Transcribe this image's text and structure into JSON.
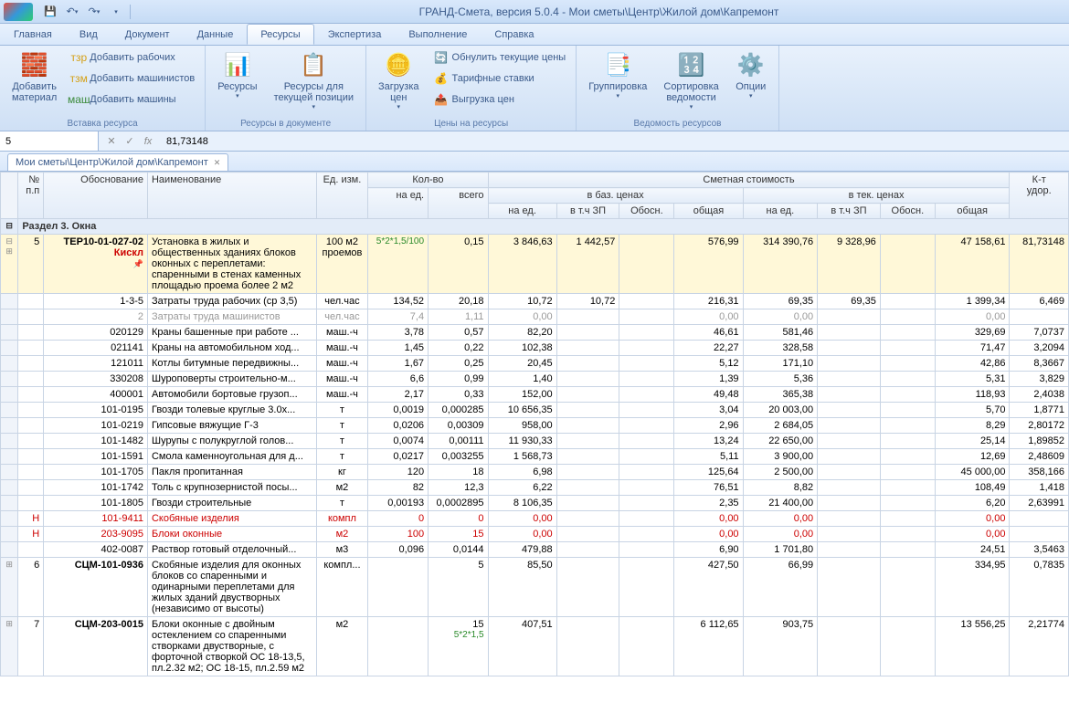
{
  "title": "ГРАНД-Смета, версия 5.0.4 - Мои сметы\\Центр\\Жилой дом\\Капремонт",
  "menu": [
    "Главная",
    "Вид",
    "Документ",
    "Данные",
    "Ресурсы",
    "Экспертиза",
    "Выполнение",
    "Справка"
  ],
  "menu_active": 4,
  "ribbon": {
    "g1": {
      "label": "Вставка ресурса",
      "add_mat": "Добавить\nматериал",
      "add_wrk": "Добавить рабочих",
      "add_mash": "Добавить машинистов",
      "add_m": "Добавить машины"
    },
    "g2": {
      "label": "Ресурсы в документе",
      "res": "Ресурсы",
      "res_pos": "Ресурсы для\nтекущей позиции"
    },
    "g3": {
      "label": "Цены на ресурсы",
      "load": "Загрузка\nцен",
      "reset": "Обнулить текущие цены",
      "tarif": "Тарифные ставки",
      "unload": "Выгрузка цен"
    },
    "g4": {
      "label": "Ведомость ресурсов",
      "grp": "Группировка",
      "sort": "Сортировка\nведомости",
      "opt": "Опции"
    }
  },
  "formula": {
    "cell": "5",
    "value": "81,73148"
  },
  "doc_tab": "Мои сметы\\Центр\\Жилой дом\\Капремонт",
  "headers": {
    "npp": "№\nп.п",
    "obos": "Обоснование",
    "name": "Наименование",
    "ed": "Ед. изм.",
    "kv": "Кол-во",
    "kv_ed": "на ед.",
    "kv_all": "всего",
    "sm": "Сметная стоимость",
    "baz": "в баз. ценах",
    "tek": "в тек. ценах",
    "na_ed": "на ед.",
    "zp": "в т.ч ЗП",
    "obosn": "Обосн.",
    "obsh": "общая",
    "kt": "К-т\nудор."
  },
  "section": "Раздел 3. Окна",
  "rows": [
    {
      "n": "5",
      "o": "ТЕР10-01-027-02",
      "kiskl": "Кискл",
      "nm": "Установка в жилых и общественных зданиях блоков оконных с переплетами: спаренными в стенах каменных площадью проема более 2 м2",
      "ed": "100 м2 проемов",
      "kved": "",
      "kvedf": "5*2*1,5/100",
      "kvall": "0,15",
      "b1": "3 846,63",
      "b2": "1 442,57",
      "b3": "",
      "b4": "576,99",
      "t1": "314 390,76",
      "t2": "9 328,96",
      "t3": "",
      "t4": "47 158,61",
      "kt": "81,73148",
      "main": true,
      "pin": true
    },
    {
      "o": "1-3-5",
      "nm": "Затраты труда рабочих (ср 3,5)",
      "ed": "чел.час",
      "kved": "134,52",
      "kvall": "20,18",
      "b1": "10,72",
      "b2": "10,72",
      "b4": "216,31",
      "t1": "69,35",
      "t2": "69,35",
      "t4": "1 399,34",
      "kt": "6,469"
    },
    {
      "o": "2",
      "nm": "Затраты труда машинистов",
      "ed": "чел.час",
      "kved": "7,4",
      "kvall": "1,11",
      "b1": "0,00",
      "b4": "0,00",
      "t1": "0,00",
      "t4": "0,00",
      "gray": true
    },
    {
      "o": "020129",
      "nm": "Краны башенные при работе ...",
      "ed": "маш.-ч",
      "kved": "3,78",
      "kvall": "0,57",
      "b1": "82,20",
      "b4": "46,61",
      "t1": "581,46",
      "t4": "329,69",
      "kt": "7,0737"
    },
    {
      "o": "021141",
      "nm": "Краны на автомобильном ход...",
      "ed": "маш.-ч",
      "kved": "1,45",
      "kvall": "0,22",
      "b1": "102,38",
      "b4": "22,27",
      "t1": "328,58",
      "t4": "71,47",
      "kt": "3,2094"
    },
    {
      "o": "121011",
      "nm": "Котлы битумные передвижны...",
      "ed": "маш.-ч",
      "kved": "1,67",
      "kvall": "0,25",
      "b1": "20,45",
      "b4": "5,12",
      "t1": "171,10",
      "t4": "42,86",
      "kt": "8,3667"
    },
    {
      "o": "330208",
      "nm": "Шуроповерты строительно-м...",
      "ed": "маш.-ч",
      "kved": "6,6",
      "kvall": "0,99",
      "b1": "1,40",
      "b4": "1,39",
      "t1": "5,36",
      "t4": "5,31",
      "kt": "3,829"
    },
    {
      "o": "400001",
      "nm": "Автомобили бортовые грузоп...",
      "ed": "маш.-ч",
      "kved": "2,17",
      "kvall": "0,33",
      "b1": "152,00",
      "b4": "49,48",
      "t1": "365,38",
      "t4": "118,93",
      "kt": "2,4038"
    },
    {
      "o": "101-0195",
      "nm": "Гвозди толевые круглые 3.0х...",
      "ed": "т",
      "kved": "0,0019",
      "kvall": "0,000285",
      "b1": "10 656,35",
      "b4": "3,04",
      "t1": "20 003,00",
      "t4": "5,70",
      "kt": "1,8771"
    },
    {
      "o": "101-0219",
      "nm": "Гипсовые вяжущие Г-3",
      "ed": "т",
      "kved": "0,0206",
      "kvall": "0,00309",
      "b1": "958,00",
      "b4": "2,96",
      "t1": "2 684,05",
      "t4": "8,29",
      "kt": "2,80172"
    },
    {
      "o": "101-1482",
      "nm": "Шурупы с полукруглой голов...",
      "ed": "т",
      "kved": "0,0074",
      "kvall": "0,00111",
      "b1": "11 930,33",
      "b4": "13,24",
      "t1": "22 650,00",
      "t4": "25,14",
      "kt": "1,89852"
    },
    {
      "o": "101-1591",
      "nm": "Смола каменноугольная для д...",
      "ed": "т",
      "kved": "0,0217",
      "kvall": "0,003255",
      "b1": "1 568,73",
      "b4": "5,11",
      "t1": "3 900,00",
      "t4": "12,69",
      "kt": "2,48609"
    },
    {
      "o": "101-1705",
      "nm": "Пакля пропитанная",
      "ed": "кг",
      "kved": "120",
      "kvall": "18",
      "b1": "6,98",
      "b4": "125,64",
      "t1": "2 500,00",
      "t4": "45 000,00",
      "kt": "358,166"
    },
    {
      "o": "101-1742",
      "nm": "Толь с крупнозернистой посы...",
      "ed": "м2",
      "kved": "82",
      "kvall": "12,3",
      "b1": "6,22",
      "b4": "76,51",
      "t1": "8,82",
      "t4": "108,49",
      "kt": "1,418"
    },
    {
      "o": "101-1805",
      "nm": "Гвозди строительные",
      "ed": "т",
      "kved": "0,00193",
      "kvall": "0,0002895",
      "b1": "8 106,35",
      "b4": "2,35",
      "t1": "21 400,00",
      "t4": "6,20",
      "kt": "2,63991"
    },
    {
      "o": "101-9411",
      "nm": "Скобяные изделия",
      "ed": "компл",
      "kved": "0",
      "kvall": "0",
      "b1": "0,00",
      "b4": "0,00",
      "t1": "0,00",
      "t4": "0,00",
      "red": true,
      "h": "Н"
    },
    {
      "o": "203-9095",
      "nm": "Блоки оконные",
      "ed": "м2",
      "kved": "100",
      "kvall": "15",
      "b1": "0,00",
      "b4": "0,00",
      "t1": "0,00",
      "t4": "0,00",
      "red": true,
      "h": "Н"
    },
    {
      "o": "402-0087",
      "nm": "Раствор готовый отделочный...",
      "ed": "м3",
      "kved": "0,096",
      "kvall": "0,0144",
      "b1": "479,88",
      "b4": "6,90",
      "t1": "1 701,80",
      "t4": "24,51",
      "kt": "3,5463"
    },
    {
      "n": "6",
      "o": "СЦМ-101-0936",
      "nm": "Скобяные изделия для оконных блоков со спаренными и одинарными переплетами для жилых зданий двустворных (независимо от высоты)",
      "ed": "компл...",
      "kved": "",
      "kvall": "5",
      "b1": "85,50",
      "b4": "427,50",
      "t1": "66,99",
      "t4": "334,95",
      "kt": "0,7835",
      "bold": true
    },
    {
      "n": "7",
      "o": "СЦМ-203-0015",
      "nm": "Блоки оконные с двойным остеклением со спаренными створками двустворные, с форточной створкой ОС 18-13,5, пл.2.32 м2; ОС 18-15, пл.2.59 м2",
      "ed": "м2",
      "kved": "",
      "kvedf": "5*2*1,5",
      "kvall": "15",
      "b1": "407,51",
      "b4": "6 112,65",
      "t1": "903,75",
      "t4": "13 556,25",
      "kt": "2,21774",
      "bold": true
    }
  ]
}
